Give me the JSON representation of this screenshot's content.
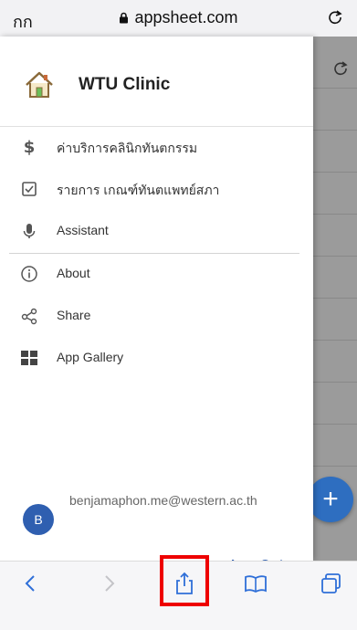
{
  "browser": {
    "text_size_label": "กก",
    "url": "appsheet.com"
  },
  "drawer": {
    "app_title": "WTU Clinic",
    "menu": [
      {
        "label": "ค่าบริการคลินิกทันตกรรม",
        "icon": "dollar-icon"
      },
      {
        "label": "รายการ เกณฑ์ทันตแพทย์สภา",
        "icon": "checkbox-icon"
      },
      {
        "label": "Assistant",
        "icon": "microphone-icon"
      },
      {
        "label": "About",
        "icon": "info-icon"
      },
      {
        "label": "Share",
        "icon": "share-nodes-icon"
      },
      {
        "label": "App Gallery",
        "icon": "grid-icon"
      }
    ],
    "user": {
      "initial": "B",
      "email": "benjamaphon.me@western.ac.th"
    },
    "logout_label": "Log Out"
  },
  "background_app": {
    "fab_label": "+"
  },
  "colors": {
    "accent": "#2f5fb0",
    "highlight": "#ee0000",
    "overlay": "#9b9b9b"
  }
}
